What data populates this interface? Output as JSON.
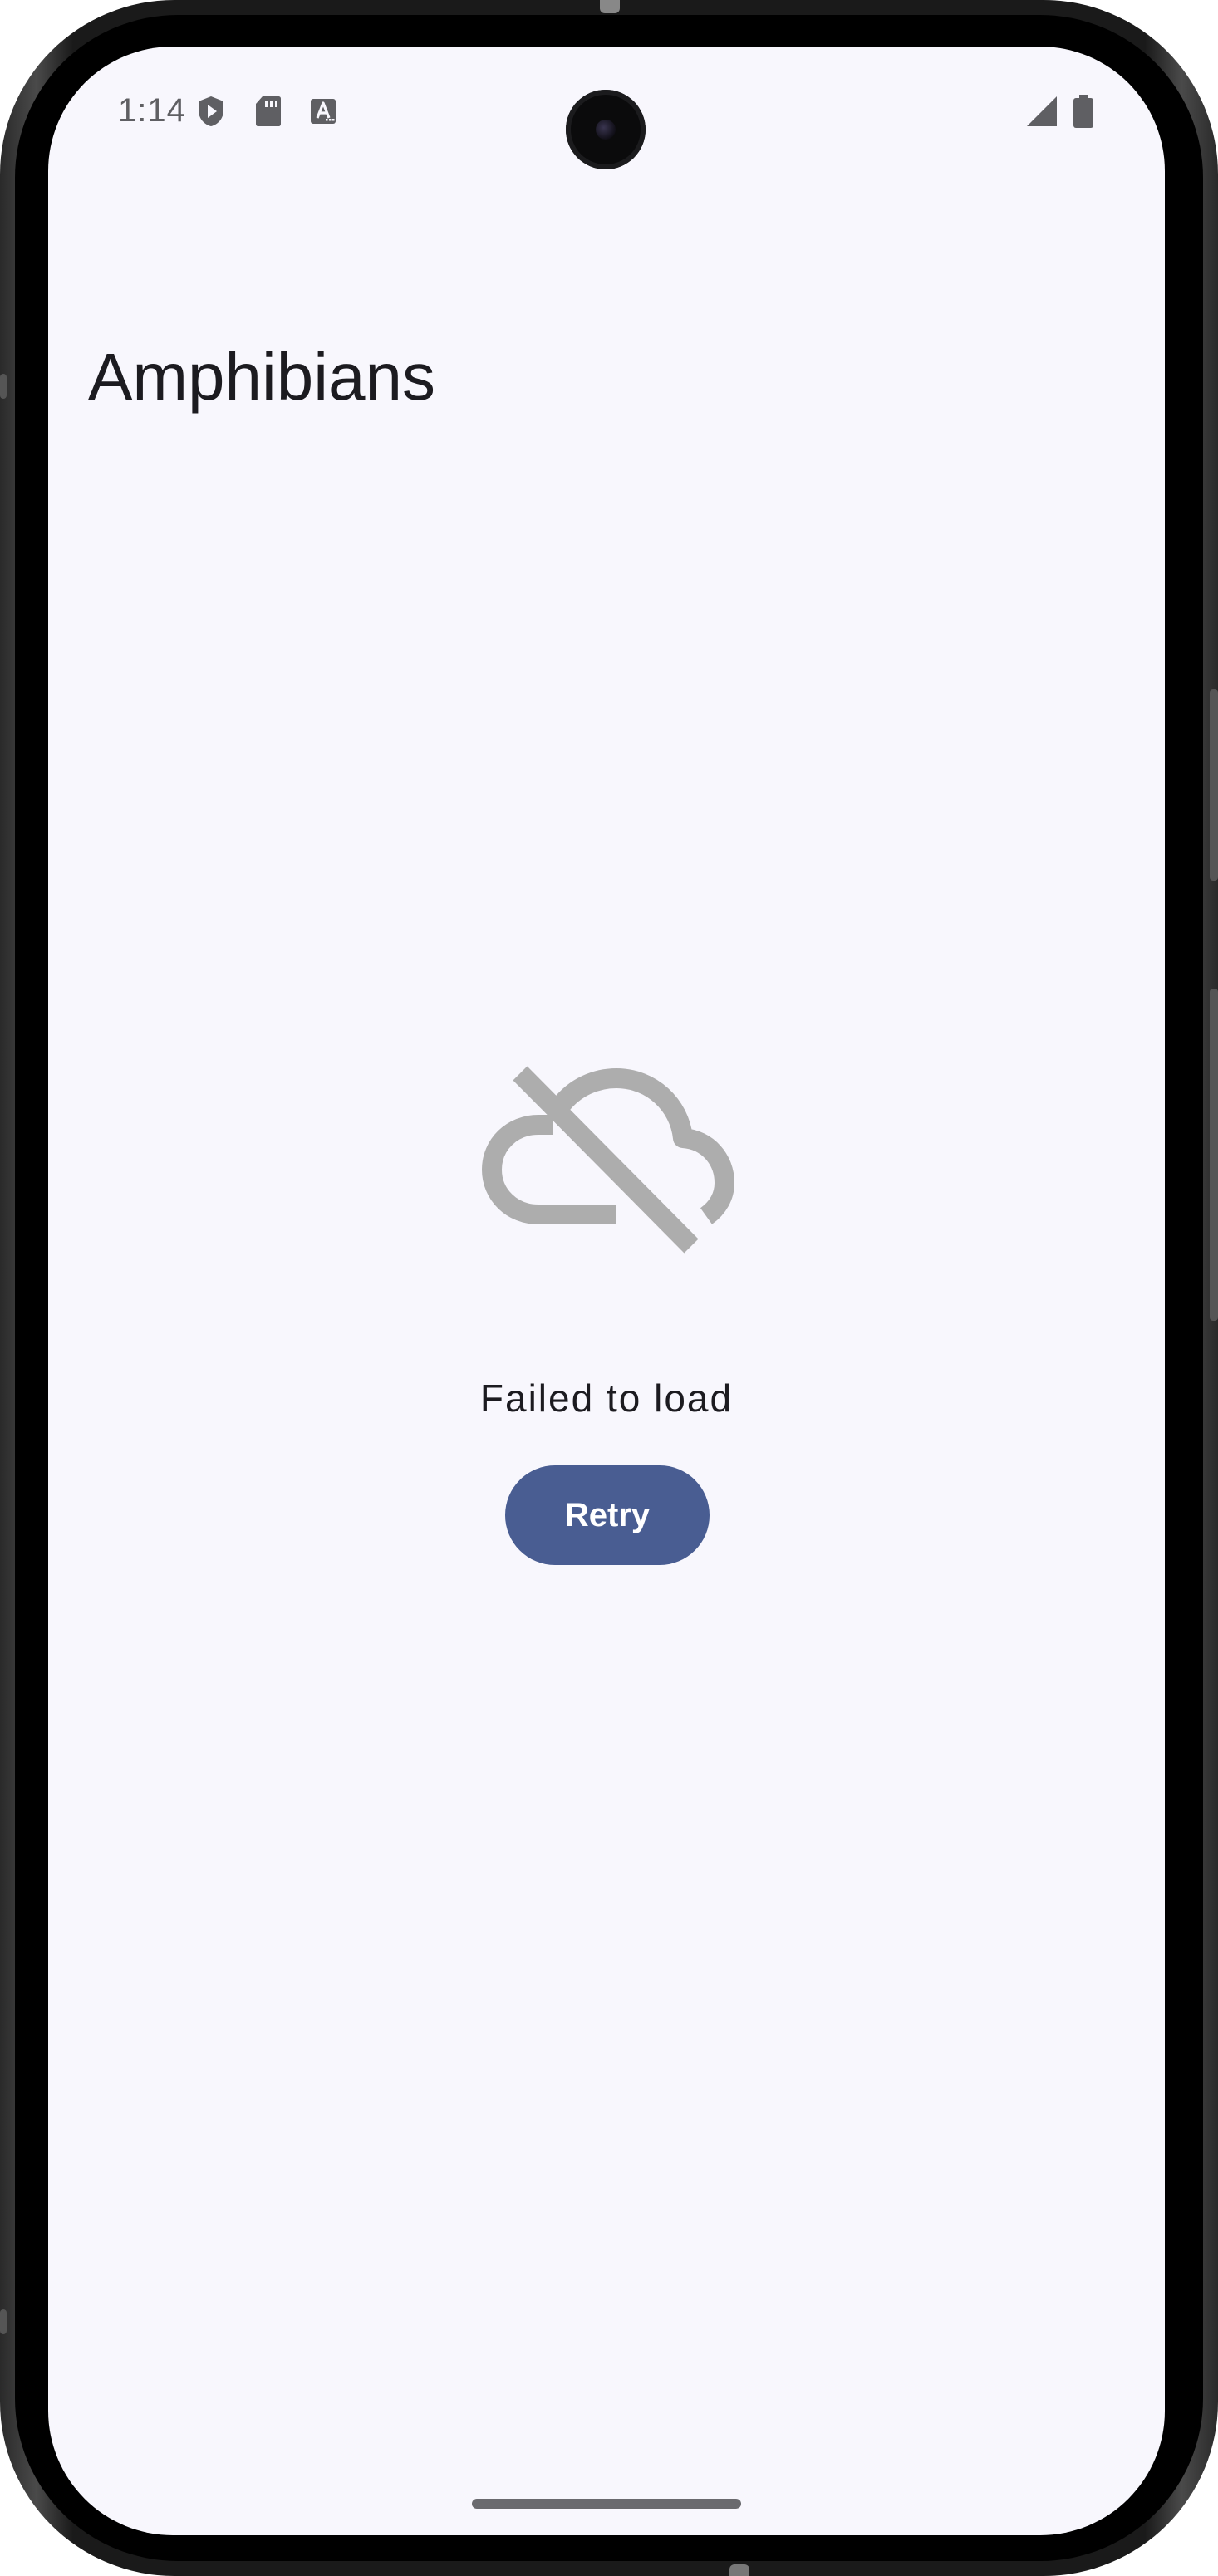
{
  "status_bar": {
    "time": "1:14",
    "icons": [
      "play-protect-icon",
      "sd-card-icon",
      "keyboard-a-icon",
      "signal-icon",
      "battery-icon"
    ]
  },
  "app_bar": {
    "title": "Amphibians"
  },
  "error_state": {
    "icon": "cloud-off-icon",
    "message": "Failed to load",
    "retry_label": "Retry"
  },
  "colors": {
    "background": "#f8f7fd",
    "primary": "#495d92",
    "on_primary": "#ffffff",
    "icon_muted": "#adadad",
    "text": "#1c1b20"
  }
}
